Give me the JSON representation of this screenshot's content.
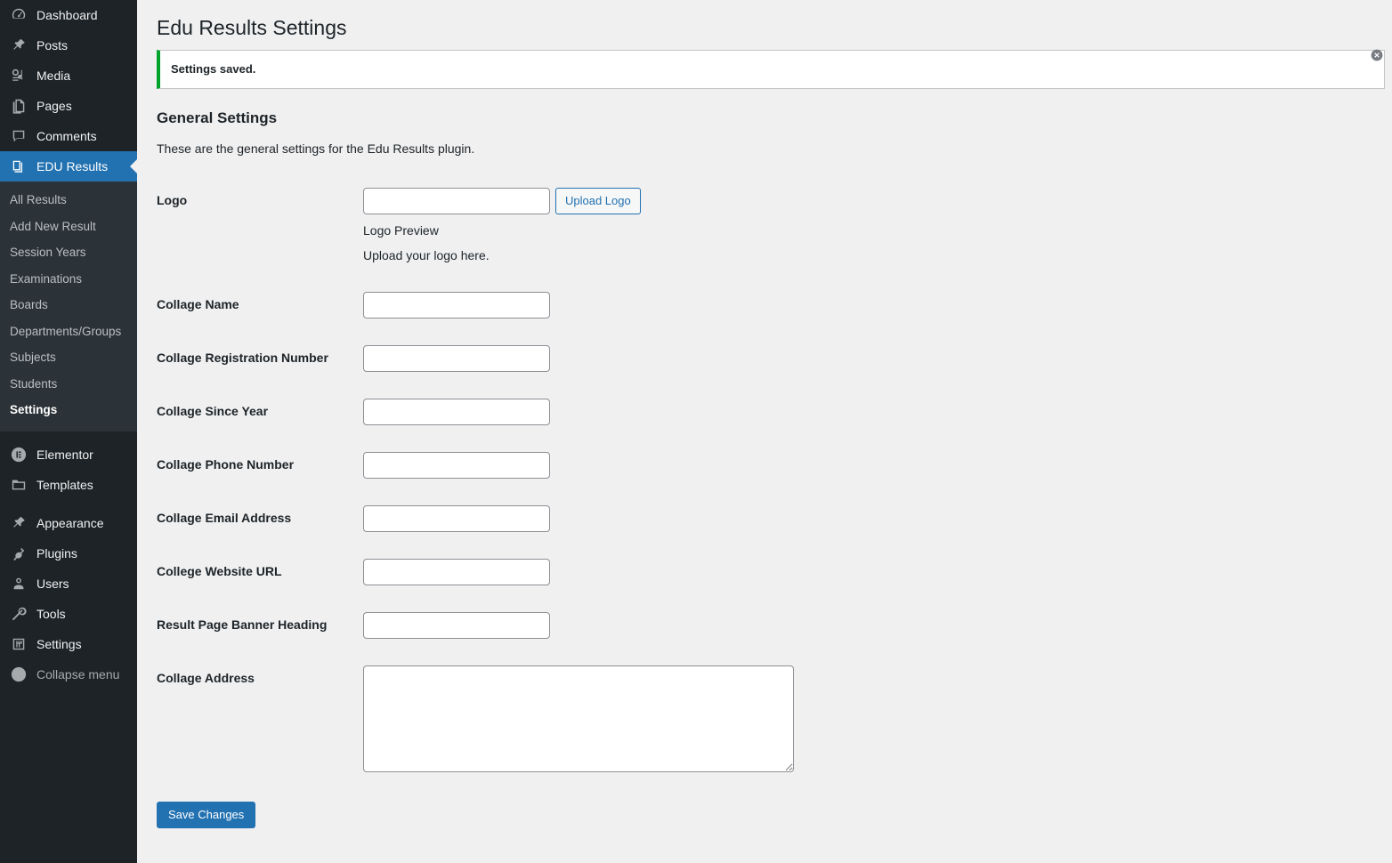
{
  "sidebar": {
    "top_items": [
      {
        "label": "Dashboard",
        "icon": "dashboard-icon",
        "active": false
      },
      {
        "label": "Posts",
        "icon": "pin-icon",
        "active": false
      },
      {
        "label": "Media",
        "icon": "media-icon",
        "active": false
      },
      {
        "label": "Pages",
        "icon": "pages-icon",
        "active": false
      },
      {
        "label": "Comments",
        "icon": "comments-icon",
        "active": false
      },
      {
        "label": "EDU Results",
        "icon": "edu-results-icon",
        "active": true
      }
    ],
    "submenu": [
      {
        "label": "All Results",
        "current": false
      },
      {
        "label": "Add New Result",
        "current": false
      },
      {
        "label": "Session Years",
        "current": false
      },
      {
        "label": "Examinations",
        "current": false
      },
      {
        "label": "Boards",
        "current": false
      },
      {
        "label": "Departments/Groups",
        "current": false
      },
      {
        "label": "Subjects",
        "current": false
      },
      {
        "label": "Students",
        "current": false
      },
      {
        "label": "Settings",
        "current": true
      }
    ],
    "plugin_items": [
      {
        "label": "Elementor",
        "icon": "elementor-icon"
      },
      {
        "label": "Templates",
        "icon": "folder-icon"
      }
    ],
    "bottom_items": [
      {
        "label": "Appearance",
        "icon": "appearance-icon"
      },
      {
        "label": "Plugins",
        "icon": "plugin-icon"
      },
      {
        "label": "Users",
        "icon": "users-icon"
      },
      {
        "label": "Tools",
        "icon": "tools-icon"
      },
      {
        "label": "Settings",
        "icon": "settings-icon"
      }
    ],
    "collapse": {
      "label": "Collapse menu",
      "icon": "collapse-arrow-icon"
    }
  },
  "page": {
    "title": "Edu Results Settings",
    "notice": {
      "text": "Settings saved.",
      "accent_color": "#00a32a",
      "dismiss_icon": "close-icon"
    },
    "section_title": "General Settings",
    "section_description": "These are the general settings for the Edu Results plugin."
  },
  "form": {
    "fields": [
      {
        "label": "Logo",
        "type": "logo",
        "value": "",
        "placeholder": ""
      },
      {
        "label": "Collage Name",
        "type": "text",
        "value": "",
        "placeholder": ""
      },
      {
        "label": "Collage Registration Number",
        "type": "text",
        "value": "",
        "placeholder": ""
      },
      {
        "label": "Collage Since Year",
        "type": "text",
        "value": "",
        "placeholder": ""
      },
      {
        "label": "Collage Phone Number",
        "type": "text",
        "value": "",
        "placeholder": ""
      },
      {
        "label": "Collage Email Address",
        "type": "text",
        "value": "",
        "placeholder": ""
      },
      {
        "label": "College Website URL",
        "type": "text",
        "value": "",
        "placeholder": ""
      },
      {
        "label": "Result Page Banner Heading",
        "type": "text",
        "value": "",
        "placeholder": ""
      },
      {
        "label": "Collage Address",
        "type": "textarea",
        "value": "",
        "placeholder": ""
      }
    ],
    "logo": {
      "upload_button": "Upload Logo",
      "preview_label": "Logo Preview",
      "help_text": "Upload your logo here."
    },
    "submit_label": "Save Changes"
  },
  "colors": {
    "sidebar_bg": "#1d2327",
    "submenu_bg": "#2c3338",
    "accent_blue": "#2271b1",
    "page_bg": "#f0f0f1",
    "notice_green": "#00a32a"
  }
}
